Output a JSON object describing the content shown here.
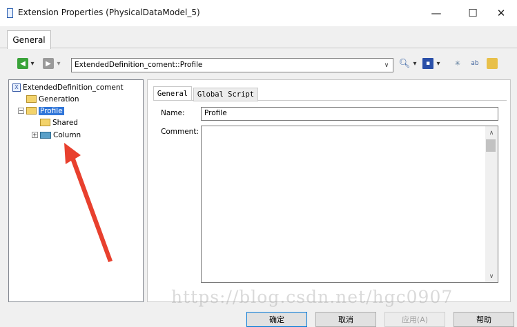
{
  "window": {
    "title": "Extension Properties (PhysicalDataModel_5)",
    "minimize": "—",
    "maximize": "☐",
    "close": "✕"
  },
  "tabs": {
    "general": "General"
  },
  "toolbar": {
    "combo_value": "ExtendedDefinition_coment::Profile",
    "icons": [
      "back-icon",
      "forward-icon",
      "find-icon",
      "save-icon",
      "properties-icon",
      "rename-icon",
      "tools-icon"
    ]
  },
  "tree": {
    "root": "ExtendedDefinition_coment",
    "generation": "Generation",
    "profile": "Profile",
    "shared": "Shared",
    "column": "Column"
  },
  "panel": {
    "tab_general": "General",
    "tab_global_script": "Global Script",
    "name_label": "Name:",
    "name_value": "Profile",
    "comment_label": "Comment:"
  },
  "buttons": {
    "ok": "确定",
    "cancel": "取消",
    "apply": "应用(A)",
    "help": "帮助"
  },
  "watermark": "https://blog.csdn.net/hgc0907",
  "colors": {
    "selection": "#3176d9",
    "annotation_arrow": "#e8402e"
  }
}
